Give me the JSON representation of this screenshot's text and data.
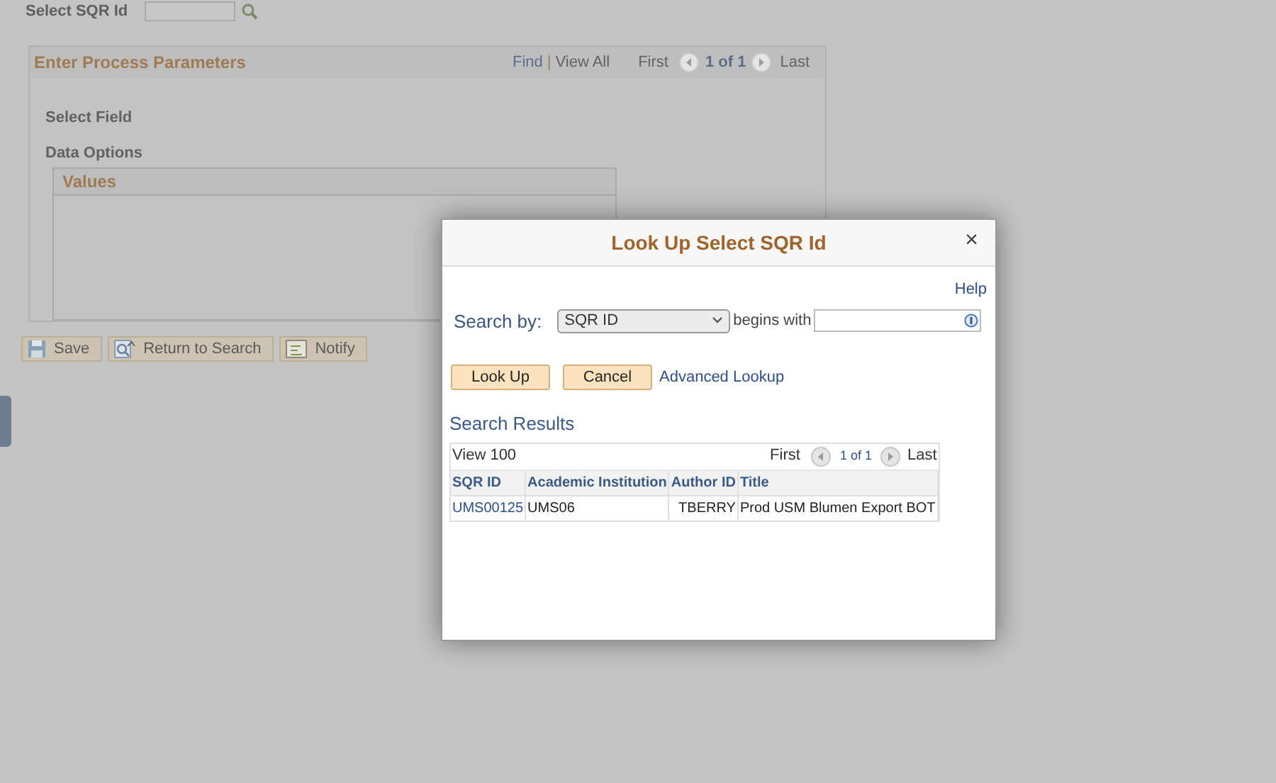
{
  "page": {
    "search_field": {
      "label": "Select SQR Id"
    },
    "panel": {
      "title": "Enter Process Parameters",
      "find_link": "Find",
      "separator": "|",
      "view_all": "View All",
      "first": "First",
      "page_count": "1 of 1",
      "last": "Last",
      "fields": [
        "Select Field",
        "Data Options"
      ],
      "grid_title": "Values"
    },
    "buttons": [
      "Save",
      "Return to Search",
      "Notify"
    ]
  },
  "dialog": {
    "title": "Look Up Select SQR Id",
    "close": "×",
    "help": "Help",
    "search_by_label": "Search by:",
    "search_by_value": "SQR ID",
    "operator": "begins with",
    "buttons": [
      "Look Up",
      "Cancel"
    ],
    "advanced_link": "Advanced Lookup",
    "results": {
      "title": "Search Results",
      "view": "View 100",
      "first": "First",
      "page_count": "1 of 1",
      "last": "Last",
      "columns": [
        "SQR ID",
        "Academic Institution",
        "Author ID",
        "Title"
      ],
      "rows": [
        [
          "UMS00125",
          "UMS06",
          "TBERRY",
          "Prod USM Blumen Export BOT"
        ]
      ]
    }
  }
}
